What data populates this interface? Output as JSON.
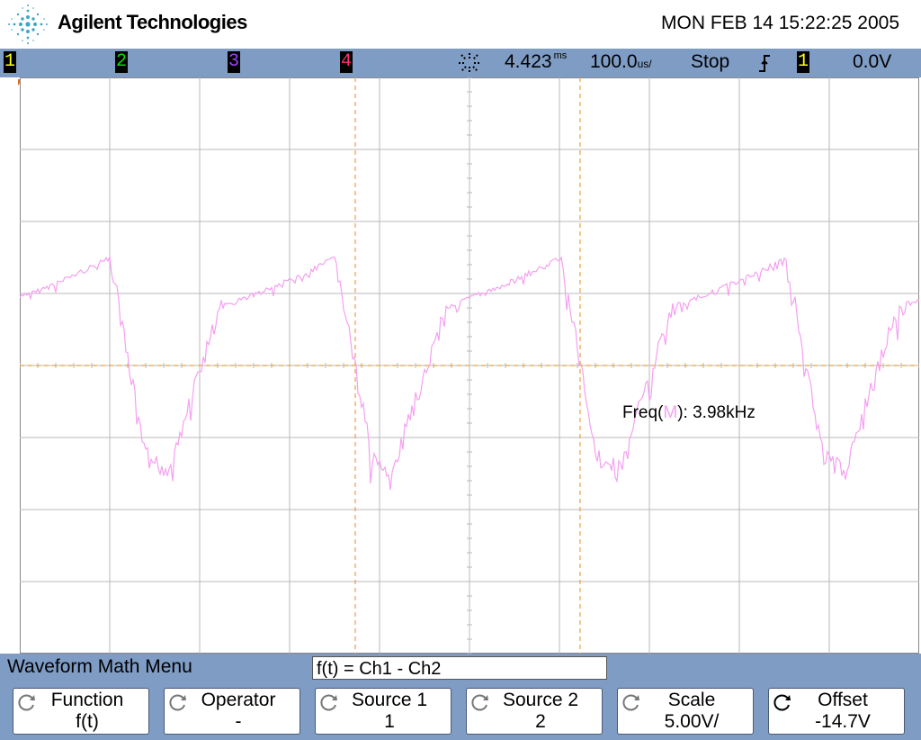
{
  "header": {
    "brand": "Agilent Technologies",
    "datetime": "MON FEB 14 15:22:25 2005"
  },
  "status": {
    "channels": [
      {
        "label": "1",
        "color": "#ffff00"
      },
      {
        "label": "2",
        "color": "#00e000"
      },
      {
        "label": "3",
        "color": "#a040ff"
      },
      {
        "label": "4",
        "color": "#ff3070"
      }
    ],
    "delay": "4.423",
    "delay_unit": "ms",
    "timebase": "100.0",
    "timebase_unit": "us/",
    "run_state": "Stop",
    "trigger_slope": "falling",
    "trigger_channel": "1",
    "trigger_level": "0.0V"
  },
  "screen": {
    "measurement_label": "Freq(",
    "measurement_source": "M",
    "measurement_value": "): 3.98kHz",
    "trace_color": "#f5a0f0",
    "cursor_color": "#e8a040",
    "grid_color": "#b8b8b8"
  },
  "menu": {
    "title": "Waveform Math Menu",
    "formula": "f(t) = Ch1 - Ch2",
    "softkeys": [
      {
        "label": "Function",
        "value": "f(t)"
      },
      {
        "label": "Operator",
        "value": "-"
      },
      {
        "label": "Source 1",
        "value": "1"
      },
      {
        "label": "Source 2",
        "value": "2"
      },
      {
        "label": "Scale",
        "value": "5.00V/"
      },
      {
        "label": "Offset",
        "value": "-14.7V"
      }
    ]
  }
}
